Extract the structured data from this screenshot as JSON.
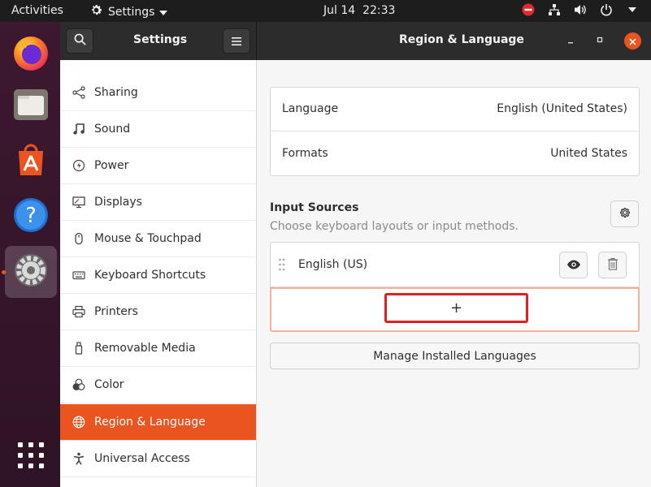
{
  "topbar": {
    "activities": "Activities",
    "app_menu": "Settings",
    "clock_date": "Jul 14",
    "clock_time": "22:33"
  },
  "dock": {
    "items": [
      "firefox",
      "files",
      "ubuntu-software",
      "help",
      "settings"
    ],
    "active": "settings",
    "show_apps": "show-applications"
  },
  "header": {
    "sidebar_title": "Settings",
    "panel_title": "Region & Language"
  },
  "sidebar": {
    "items": [
      {
        "label": "Sharing",
        "icon": "share-icon"
      },
      {
        "label": "Sound",
        "icon": "music-note-icon"
      },
      {
        "label": "Power",
        "icon": "power-icon"
      },
      {
        "label": "Displays",
        "icon": "display-icon"
      },
      {
        "label": "Mouse & Touchpad",
        "icon": "mouse-icon"
      },
      {
        "label": "Keyboard Shortcuts",
        "icon": "keyboard-icon"
      },
      {
        "label": "Printers",
        "icon": "printer-icon"
      },
      {
        "label": "Removable Media",
        "icon": "usb-drive-icon"
      },
      {
        "label": "Color",
        "icon": "color-icon"
      },
      {
        "label": "Region & Language",
        "icon": "globe-icon",
        "selected": true
      },
      {
        "label": "Universal Access",
        "icon": "accessibility-icon"
      }
    ]
  },
  "region": {
    "language_label": "Language",
    "language_value": "English (United States)",
    "formats_label": "Formats",
    "formats_value": "United States"
  },
  "input_sources": {
    "title": "Input Sources",
    "subtitle": "Choose keyboard layouts or input methods.",
    "sources": [
      {
        "name": "English (US)"
      }
    ],
    "add_label": "+",
    "manage_label": "Manage Installed Languages"
  },
  "colors": {
    "accent": "#e95420",
    "highlight_box": "#e02020",
    "headerbar": "#2c2c2c"
  }
}
